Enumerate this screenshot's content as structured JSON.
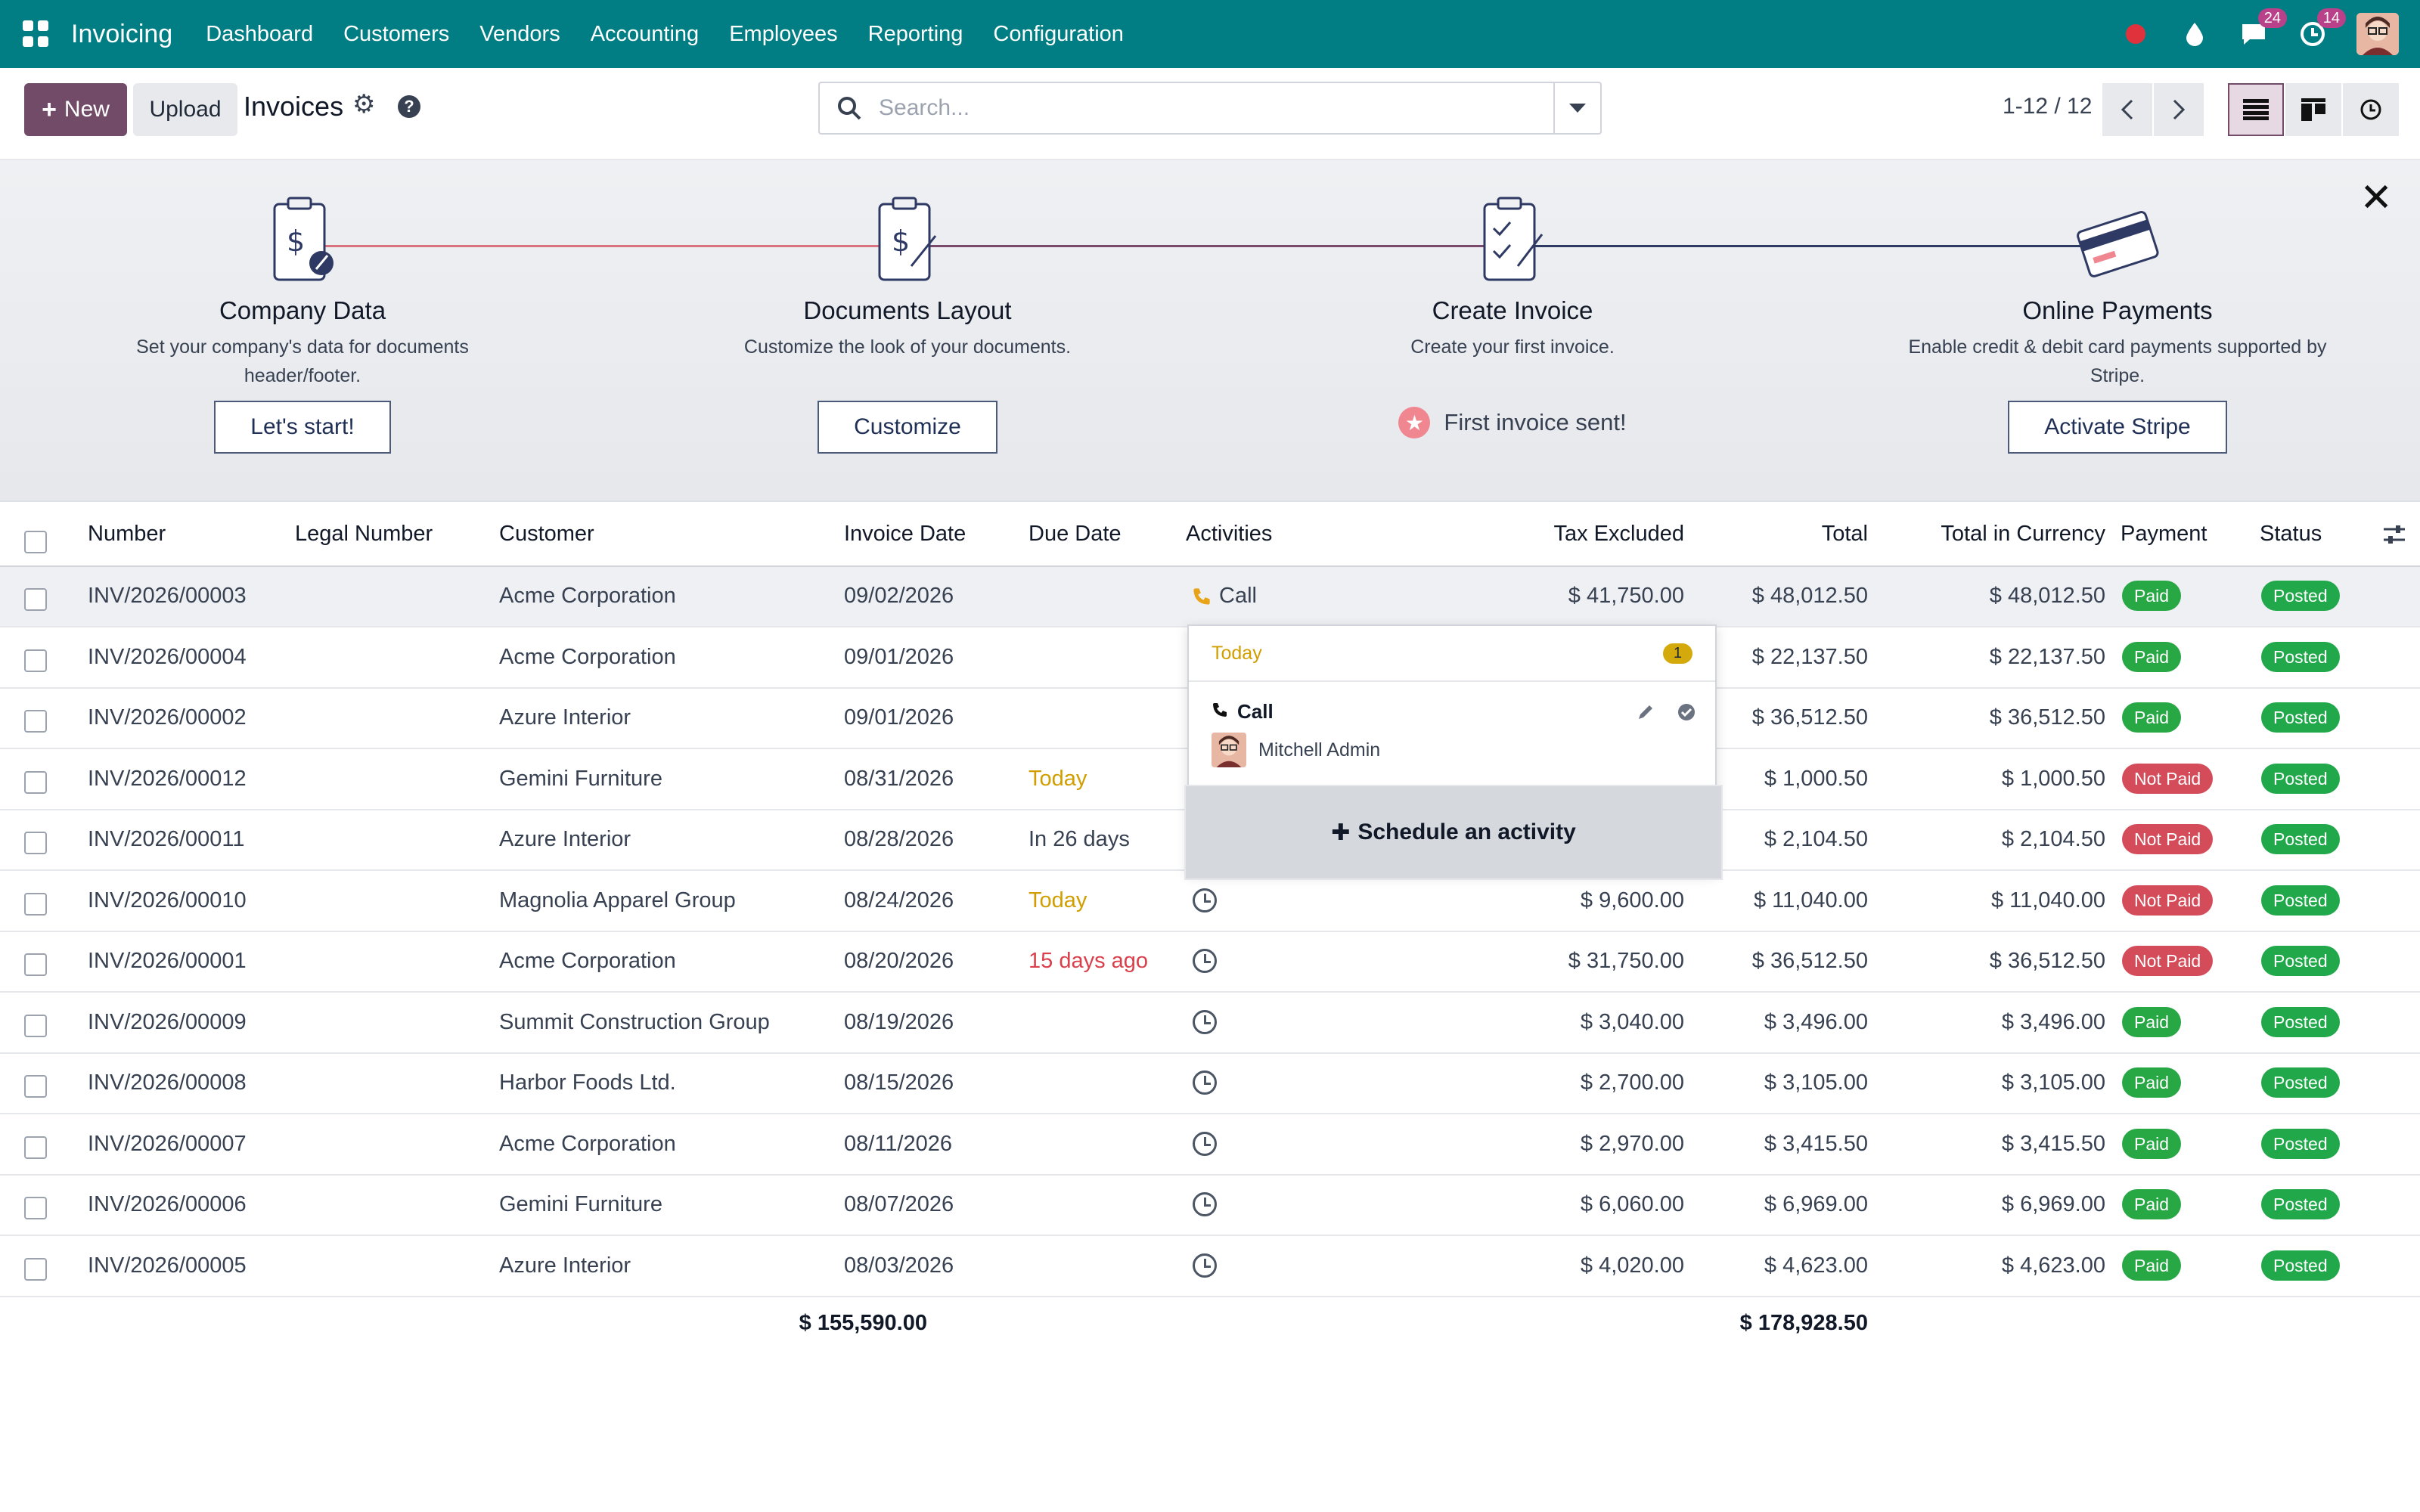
{
  "navbar": {
    "app_name": "Invoicing",
    "menu": [
      "Dashboard",
      "Customers",
      "Vendors",
      "Accounting",
      "Employees",
      "Reporting",
      "Configuration"
    ],
    "messages_count": "24",
    "activities_count": "14",
    "accent_color": "#017e84"
  },
  "control": {
    "new_label": "New",
    "upload_label": "Upload",
    "title": "Invoices",
    "search_placeholder": "Search...",
    "pager": "1-12 / 12"
  },
  "onboarding": {
    "steps": [
      {
        "title": "Company Data",
        "desc": "Set your company's data for documents header/footer.",
        "button": "Let's start!"
      },
      {
        "title": "Documents Layout",
        "desc": "Customize the look of your documents.",
        "button": "Customize"
      },
      {
        "title": "Create Invoice",
        "desc": "Create your first invoice.",
        "done": "First invoice sent!"
      },
      {
        "title": "Online Payments",
        "desc": "Enable credit & debit card payments supported by Stripe.",
        "button": "Activate Stripe"
      }
    ]
  },
  "table": {
    "columns": [
      "Number",
      "Legal Number",
      "Customer",
      "Invoice Date",
      "Due Date",
      "Activities",
      "Tax Excluded",
      "Total",
      "Total in Currency",
      "Payment",
      "Status"
    ],
    "rows": [
      {
        "number": "INV/2026/00003",
        "customer": "Acme Corporation",
        "date": "09/02/2026",
        "due": "",
        "activity": "Call",
        "tax_excl": "$ 41,750.00",
        "total": "$ 48,012.50",
        "total_cur": "$ 48,012.50",
        "payment": "Paid",
        "status": "Posted"
      },
      {
        "number": "INV/2026/00004",
        "customer": "Acme Corporation",
        "date": "09/01/2026",
        "due": "",
        "activity": "",
        "tax_excl": "",
        "total": "$ 22,137.50",
        "total_cur": "$ 22,137.50",
        "payment": "Paid",
        "status": "Posted"
      },
      {
        "number": "INV/2026/00002",
        "customer": "Azure Interior",
        "date": "09/01/2026",
        "due": "",
        "activity": "",
        "tax_excl": "",
        "total": "$ 36,512.50",
        "total_cur": "$ 36,512.50",
        "payment": "Paid",
        "status": "Posted"
      },
      {
        "number": "INV/2026/00012",
        "customer": "Gemini Furniture",
        "date": "08/31/2026",
        "due": "Today",
        "activity": "",
        "tax_excl": "",
        "total": "$ 1,000.50",
        "total_cur": "$ 1,000.50",
        "payment": "Not Paid",
        "status": "Posted"
      },
      {
        "number": "INV/2026/00011",
        "customer": "Azure Interior",
        "date": "08/28/2026",
        "due": "In 26 days",
        "activity": "",
        "tax_excl": "",
        "total": "$ 2,104.50",
        "total_cur": "$ 2,104.50",
        "payment": "Not Paid",
        "status": "Posted"
      },
      {
        "number": "INV/2026/00010",
        "customer": "Magnolia Apparel Group",
        "date": "08/24/2026",
        "due": "Today",
        "activity": "",
        "tax_excl": "$ 9,600.00",
        "total": "$ 11,040.00",
        "total_cur": "$ 11,040.00",
        "payment": "Not Paid",
        "status": "Posted"
      },
      {
        "number": "INV/2026/00001",
        "customer": "Acme Corporation",
        "date": "08/20/2026",
        "due": "15 days ago",
        "activity": "",
        "tax_excl": "$ 31,750.00",
        "total": "$ 36,512.50",
        "total_cur": "$ 36,512.50",
        "payment": "Not Paid",
        "status": "Posted"
      },
      {
        "number": "INV/2026/00009",
        "customer": "Summit Construction Group",
        "date": "08/19/2026",
        "due": "",
        "activity": "",
        "tax_excl": "$ 3,040.00",
        "total": "$ 3,496.00",
        "total_cur": "$ 3,496.00",
        "payment": "Paid",
        "status": "Posted"
      },
      {
        "number": "INV/2026/00008",
        "customer": "Harbor Foods Ltd.",
        "date": "08/15/2026",
        "due": "",
        "activity": "",
        "tax_excl": "$ 2,700.00",
        "total": "$ 3,105.00",
        "total_cur": "$ 3,105.00",
        "payment": "Paid",
        "status": "Posted"
      },
      {
        "number": "INV/2026/00007",
        "customer": "Acme Corporation",
        "date": "08/11/2026",
        "due": "",
        "activity": "",
        "tax_excl": "$ 2,970.00",
        "total": "$ 3,415.50",
        "total_cur": "$ 3,415.50",
        "payment": "Paid",
        "status": "Posted"
      },
      {
        "number": "INV/2026/00006",
        "customer": "Gemini Furniture",
        "date": "08/07/2026",
        "due": "",
        "activity": "",
        "tax_excl": "$ 6,060.00",
        "total": "$ 6,969.00",
        "total_cur": "$ 6,969.00",
        "payment": "Paid",
        "status": "Posted"
      },
      {
        "number": "INV/2026/00005",
        "customer": "Azure Interior",
        "date": "08/03/2026",
        "due": "",
        "activity": "",
        "tax_excl": "$ 4,020.00",
        "total": "$ 4,623.00",
        "total_cur": "$ 4,623.00",
        "payment": "Paid",
        "status": "Posted"
      }
    ],
    "totals": {
      "tax_excl": "$ 155,590.00",
      "total": "$ 178,928.50"
    }
  },
  "activity_popover": {
    "group": "Today",
    "count": "1",
    "activity_type": "Call",
    "assignee": "Mitchell Admin",
    "schedule_label": "Schedule an activity"
  }
}
